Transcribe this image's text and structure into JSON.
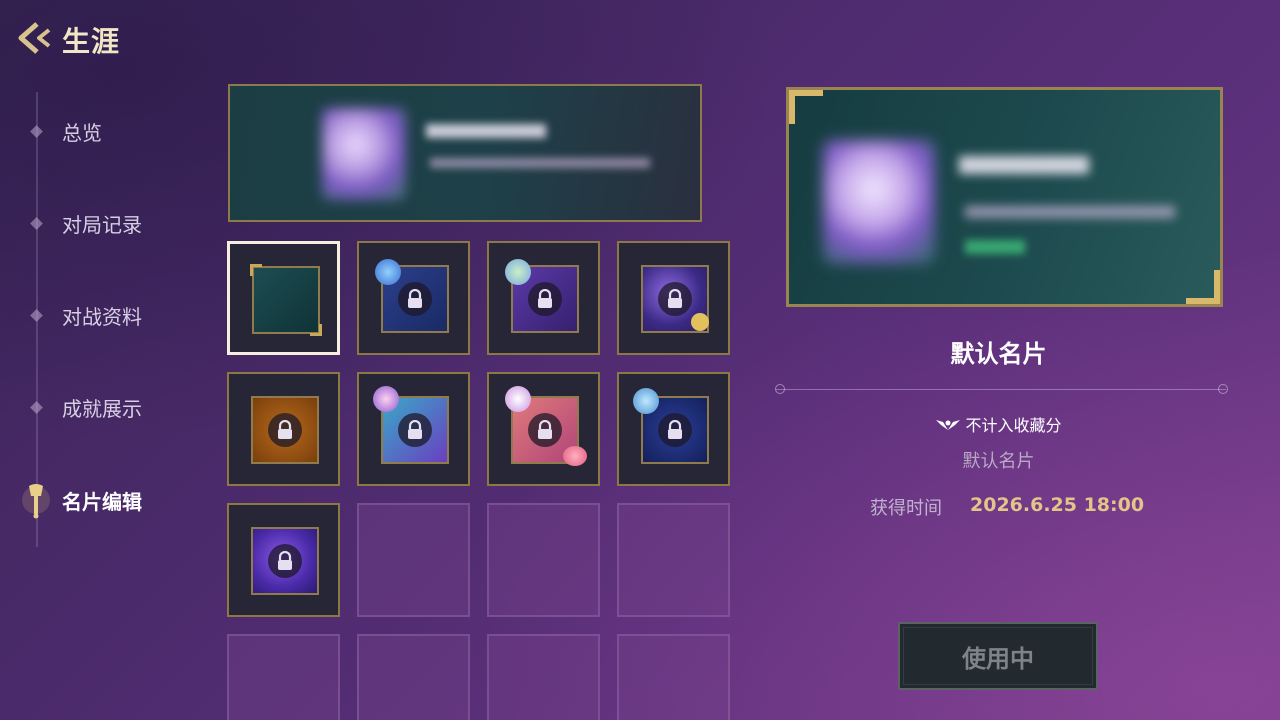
{
  "header": {
    "title": "生涯"
  },
  "sidebar": {
    "items": [
      {
        "label": "总览"
      },
      {
        "label": "对局记录"
      },
      {
        "label": "对战资料"
      },
      {
        "label": "成就展示"
      },
      {
        "label": "名片编辑",
        "active": true
      }
    ]
  },
  "grid": {
    "cells": [
      {
        "state": "selected",
        "theme": "teal"
      },
      {
        "state": "locked",
        "theme": "blue-ornate"
      },
      {
        "state": "locked",
        "theme": "purple-ornate"
      },
      {
        "state": "locked",
        "theme": "galaxy-ornate"
      },
      {
        "state": "locked",
        "theme": "amber"
      },
      {
        "state": "locked",
        "theme": "cyan-violet"
      },
      {
        "state": "locked",
        "theme": "pink-fox"
      },
      {
        "state": "locked",
        "theme": "navy-wave"
      },
      {
        "state": "locked",
        "theme": "violet-swirl"
      },
      {
        "state": "empty"
      },
      {
        "state": "empty"
      },
      {
        "state": "empty"
      },
      {
        "state": "empty"
      },
      {
        "state": "empty"
      },
      {
        "state": "empty"
      },
      {
        "state": "empty"
      }
    ]
  },
  "detail": {
    "name": "默认名片",
    "note": "不计入收藏分",
    "subtitle": "默认名片",
    "acquired_label": "获得时间",
    "acquired_value": "2026.6.25 18:00",
    "use_button": "使用中"
  },
  "colors": {
    "gold": "#8c7845",
    "accent_text": "#e3c489",
    "background": "#4a2a6a"
  }
}
